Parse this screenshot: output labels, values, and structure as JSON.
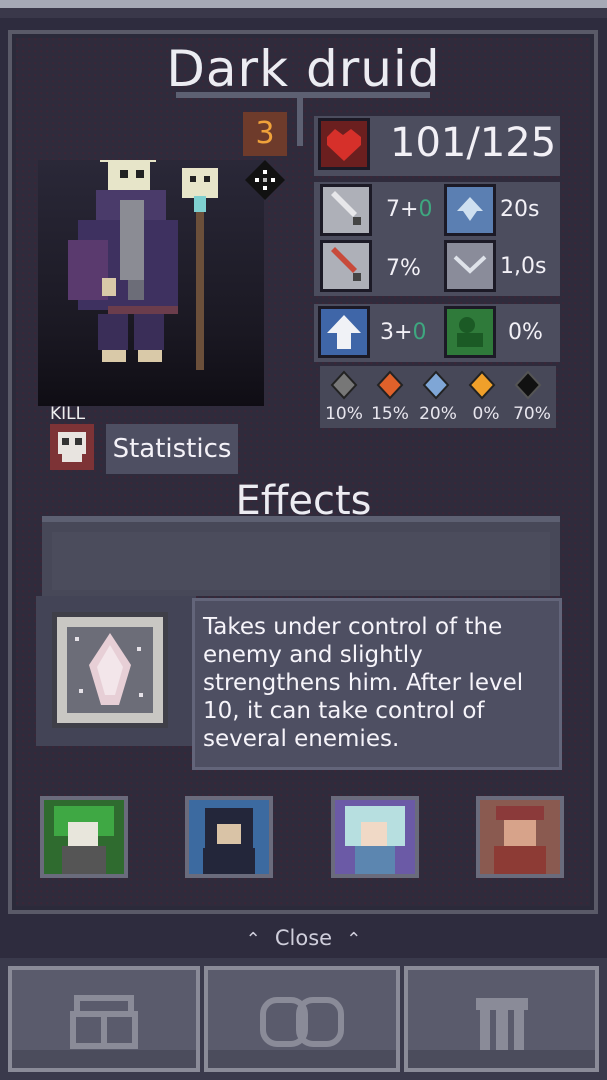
{
  "unit": {
    "name": "Dark druid",
    "level": "3",
    "element_icon": "dark-sparkle-icon"
  },
  "stats": {
    "hp": "101/125",
    "attack": {
      "base": "7+",
      "bonus": "0"
    },
    "attack_speed": "20s",
    "crit_chance": "7%",
    "cooldown": "1,0s",
    "defense": {
      "base": "3+",
      "bonus": "0"
    },
    "dodge": "0%"
  },
  "resistances": [
    {
      "icon": "neutral-resist-icon",
      "value": "10%"
    },
    {
      "icon": "fire-resist-icon",
      "value": "15%"
    },
    {
      "icon": "ice-resist-icon",
      "value": "20%"
    },
    {
      "icon": "lightning-resist-icon",
      "value": "0%"
    },
    {
      "icon": "dark-resist-icon",
      "value": "70%"
    }
  ],
  "kill_label": "KILL",
  "statistics_label": "Statistics",
  "effects_title": "Effects",
  "ability": {
    "icon": "mind-control-crystal-icon",
    "description": "Takes under control of the enemy and slightly strengthens him. After level 10, it can take control of several enemies."
  },
  "allies": [
    "green-haired-hero-portrait",
    "hooded-rogue-portrait",
    "white-haired-mage-portrait",
    "red-warrior-portrait"
  ],
  "close_label": "Close",
  "bottom_tabs": [
    "inventory-tab",
    "merge-tab",
    "armor-tab"
  ],
  "colors": {
    "hp_red": "#c8312a",
    "level_orange": "#f0a23a",
    "bonus_green": "#3ea77f",
    "panel": "#2f2b3c"
  }
}
